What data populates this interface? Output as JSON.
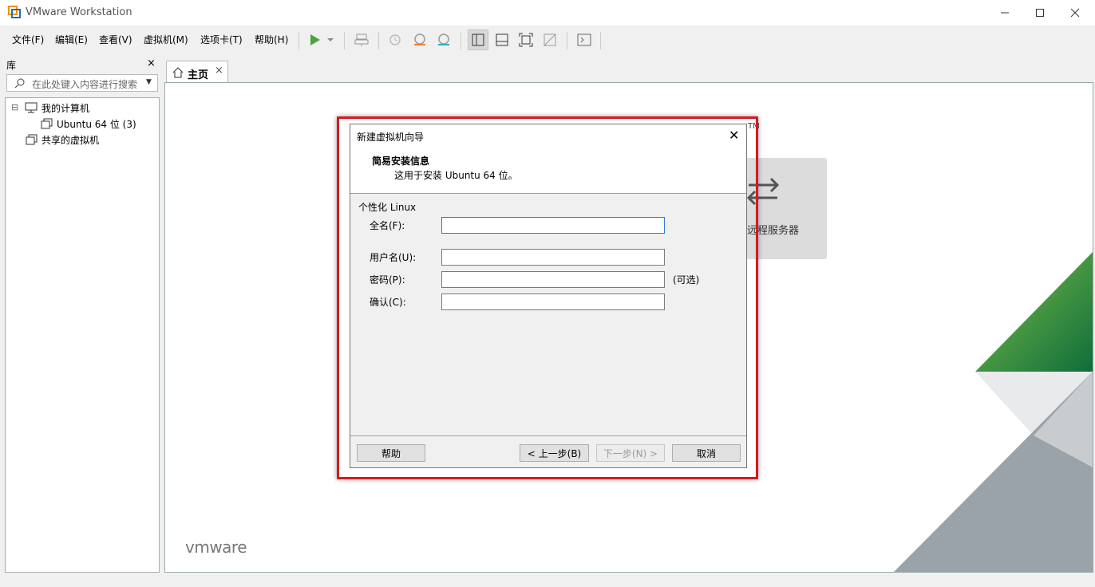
{
  "window": {
    "title": "VMware Workstation",
    "min_icon": "minimize-icon",
    "max_icon": "maximize-icon",
    "close_icon": "close-icon"
  },
  "menu": {
    "items": [
      "文件(F)",
      "编辑(E)",
      "查看(V)",
      "虚拟机(M)",
      "选项卡(T)",
      "帮助(H)"
    ]
  },
  "toolbar": {
    "icons": [
      "play-icon",
      "dropdown-icon",
      "send-keys-icon",
      "snapshot-icon",
      "revert-snapshot-icon",
      "manage-snapshots-icon",
      "library-view-icon",
      "thumbnail-bar-icon",
      "fullscreen-icon",
      "unity-icon",
      "console-icon"
    ],
    "play_color": "#4aa43c"
  },
  "library": {
    "title": "库",
    "close": "×",
    "search_placeholder": "在此处键入内容进行搜索",
    "tree": {
      "root": "我的计算机",
      "child": "Ubuntu 64 位 (3)",
      "shared": "共享的虚拟机",
      "collapse": "⊟"
    }
  },
  "tabs": {
    "home_label": "主页",
    "home_close": "×"
  },
  "home": {
    "tm": "TM",
    "remote_label": "远程服务器",
    "logo": "vmware",
    "green": "#3d9a3a",
    "gray": "#9aa3aa"
  },
  "dialog": {
    "title": "新建虚拟机向导",
    "close": "✕",
    "heading": "简易安装信息",
    "subheading": "这用于安装 Ubuntu 64 位。",
    "group": "个性化 Linux",
    "fields": {
      "fullname_label": "全名(F):",
      "fullname_value": "",
      "username_label": "用户名(U):",
      "username_value": "",
      "password_label": "密码(P):",
      "password_value": "",
      "confirm_label": "确认(C):",
      "confirm_value": ""
    },
    "optional_note": "(可选)",
    "buttons": {
      "help": "帮助",
      "back": "< 上一步(B)",
      "next": "下一步(N) >",
      "cancel": "取消"
    },
    "highlight_color": "#d9181f"
  }
}
